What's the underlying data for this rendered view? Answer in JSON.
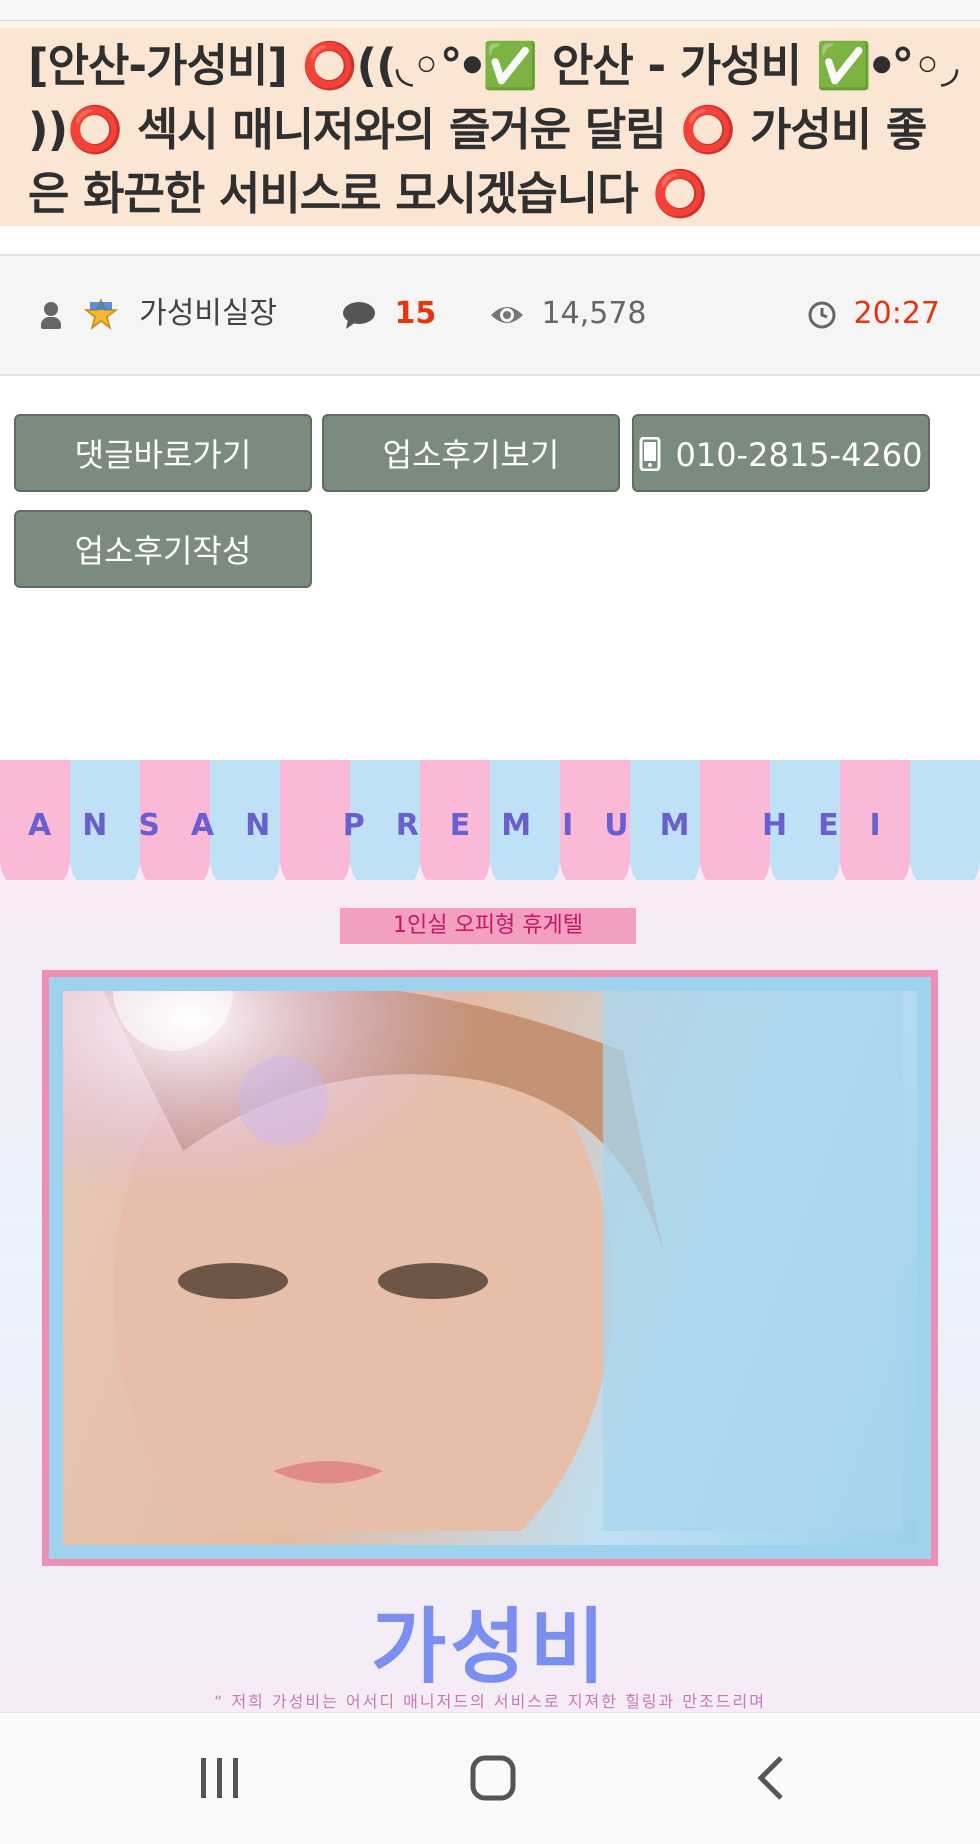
{
  "post": {
    "title": "[안산-가성비] ⭕️((◟◦°ꔷ✅ 안산 - 가성비 ✅ꔷ°◦◞ ))⭕️ 섹시 매니저와의 즐거운 달림 ⭕️ 가성비 좋은 화끈한 서비스로 모시겠습니다 ⭕️"
  },
  "meta": {
    "author": "가성비실장",
    "comment_count": "15",
    "views": "14,578",
    "time": "20:27"
  },
  "buttons": {
    "comments": "댓글바로가기",
    "reviews": "업소후기보기",
    "phone": "010-2815-4260",
    "write_review": "업소후기작성"
  },
  "poster": {
    "header": "ANSAN PREMIUM HEI",
    "room_type": "1인실 오피형 휴게텔",
    "brand": "가성비",
    "slogan": "“ 저희 가성비는 어서디 매니저드의 서비스로 지져한 힐링과 만조드리며"
  },
  "navigation": {
    "recent_apps": "recent-apps-icon",
    "home": "home-icon",
    "back": "back-icon"
  },
  "colors": {
    "title_bg": "#fbe6d4",
    "button_bg": "#7b8b7d",
    "accent": "#e8340e"
  }
}
